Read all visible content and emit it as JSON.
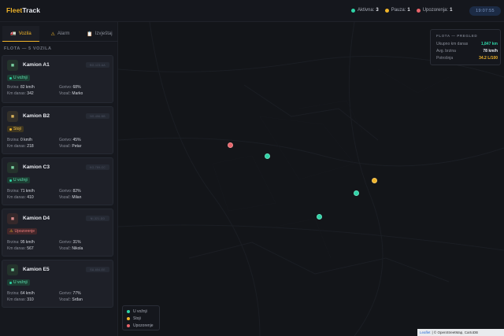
{
  "header": {
    "logo_a": "Fleet",
    "logo_b": "Track",
    "stats": [
      {
        "label": "Aktivna:",
        "count": "3",
        "color": "#2ed3a6"
      },
      {
        "label": "Pauza:",
        "count": "1",
        "color": "#f0b429"
      },
      {
        "label": "Upozorenja:",
        "count": "1",
        "color": "#e8646a"
      }
    ],
    "clock": "19:07:55"
  },
  "sidebar": {
    "tabs": [
      {
        "label": "Vozila",
        "icon": "truck-icon",
        "glyph": "🚛"
      },
      {
        "label": "Alarm",
        "icon": "warning-icon",
        "glyph": "⚠"
      },
      {
        "label": "Izvještaj",
        "icon": "report-icon",
        "glyph": "📋"
      }
    ],
    "section_title": "FLOTA — 5 VOZILA",
    "vehicles": [
      {
        "name": "Kamion A1",
        "plate": "BG-123-AA",
        "status": "U vožnji",
        "kind": "g",
        "speed_label": "Brzina:",
        "speed": "82 km/h",
        "fuel_label": "Gorivo:",
        "fuel": "68%",
        "km_label": "Km danas:",
        "km": "342",
        "driver_label": "Vozač:",
        "driver": "Marko"
      },
      {
        "name": "Kamion B2",
        "plate": "NS-456-BB",
        "status": "Stoji",
        "kind": "y",
        "speed_label": "Brzina:",
        "speed": "0 km/h",
        "fuel_label": "Gorivo:",
        "fuel": "45%",
        "km_label": "Km danas:",
        "km": "218",
        "driver_label": "Vozač:",
        "driver": "Petar"
      },
      {
        "name": "Kamion C3",
        "plate": "KG-789-CC",
        "status": "U vožnji",
        "kind": "g",
        "speed_label": "Brzina:",
        "speed": "71 km/h",
        "fuel_label": "Gorivo:",
        "fuel": "82%",
        "km_label": "Km danas:",
        "km": "410",
        "driver_label": "Vozač:",
        "driver": "Milan"
      },
      {
        "name": "Kamion D4",
        "plate": "NI-321-DD",
        "status": "Upozorenje",
        "kind": "r",
        "speed_label": "Brzina:",
        "speed": "95 km/h",
        "fuel_label": "Gorivo:",
        "fuel": "31%",
        "km_label": "Km danas:",
        "km": "567",
        "driver_label": "Vozač:",
        "driver": "Nikola"
      },
      {
        "name": "Kamion E5",
        "plate": "SU-654-EE",
        "status": "U vožnji",
        "kind": "g",
        "speed_label": "Brzina:",
        "speed": "64 km/h",
        "fuel_label": "Gorivo:",
        "fuel": "77%",
        "km_label": "Km danas:",
        "km": "310",
        "driver_label": "Vozač:",
        "driver": "Srđan"
      }
    ]
  },
  "overview": {
    "title": "FLOTA — PREGLED",
    "rows": [
      {
        "label": "Ukupno km danas",
        "value": "1,847 km",
        "color": "#2ed3a6"
      },
      {
        "label": "Avg. brzina",
        "value": "78 km/h",
        "color": "#e8eaf0"
      },
      {
        "label": "Potrošnja",
        "value": "34.2 L/100",
        "color": "#f0b429"
      }
    ]
  },
  "legend": [
    {
      "label": "U vožnji",
      "color": "#2ed3a6"
    },
    {
      "label": "Stoji",
      "color": "#f0b429"
    },
    {
      "label": "Upozorenje",
      "color": "#e8646a"
    }
  ],
  "attribution": {
    "link": "Leaflet",
    "text": "| © OpenStreetMap, CartoDB"
  },
  "colors": {
    "accent": "#f0b429",
    "moving": "#2ed3a6",
    "stopped": "#f0b429",
    "warning": "#e8646a"
  }
}
